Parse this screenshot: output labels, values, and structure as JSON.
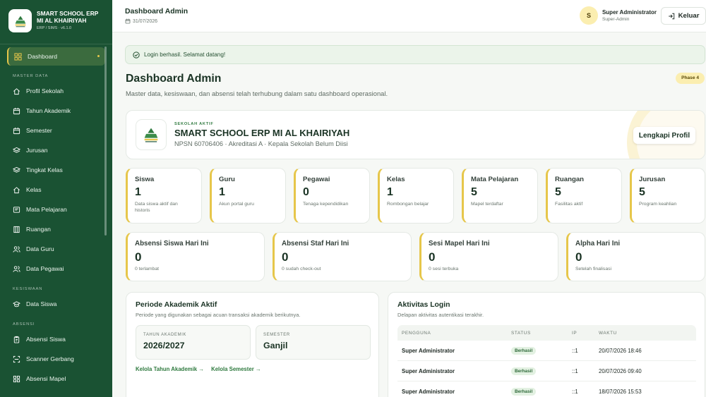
{
  "brand": {
    "name": "SMART SCHOOL ERP MI AL KHAIRIYAH",
    "sub": "ERP / SIMS · v6.1.0"
  },
  "sidebar": {
    "active": {
      "label": "Dashboard",
      "icon": "grid-icon"
    },
    "sections": [
      {
        "title": "MASTER DATA",
        "items": [
          {
            "label": "Profil Sekolah",
            "icon": "home-icon"
          },
          {
            "label": "Tahun Akademik",
            "icon": "calendar-icon"
          },
          {
            "label": "Semester",
            "icon": "calendar-icon"
          },
          {
            "label": "Jurusan",
            "icon": "layers-icon"
          },
          {
            "label": "Tingkat Kelas",
            "icon": "layers-icon"
          },
          {
            "label": "Kelas",
            "icon": "home-icon"
          },
          {
            "label": "Mata Pelajaran",
            "icon": "book-icon"
          },
          {
            "label": "Ruangan",
            "icon": "building-icon"
          },
          {
            "label": "Data Guru",
            "icon": "users-icon"
          },
          {
            "label": "Data Pegawai",
            "icon": "users-icon"
          }
        ]
      },
      {
        "title": "KESISWAAN",
        "items": [
          {
            "label": "Data Siswa",
            "icon": "graduation-cap-icon"
          }
        ]
      },
      {
        "title": "ABSENSI",
        "items": [
          {
            "label": "Absensi Siswa",
            "icon": "clipboard-icon"
          },
          {
            "label": "Scanner Gerbang",
            "icon": "scan-icon"
          },
          {
            "label": "Absensi Mapel",
            "icon": "grid-icon"
          }
        ]
      }
    ]
  },
  "header": {
    "title": "Dashboard Admin",
    "date": "31/07/2026",
    "user_initial": "S",
    "user_name": "Super Administrator",
    "user_role": "Super-Admin",
    "logout_label": "Keluar"
  },
  "alert": {
    "text": "Login berhasil. Selamat datang!"
  },
  "page": {
    "title": "Dashboard Admin",
    "subtitle": "Master data, kesiswaan, dan absensi telah terhubung dalam satu dashboard operasional.",
    "phase": "Phase 4"
  },
  "school": {
    "eyebrow": "SEKOLAH AKTIF",
    "name": "SMART SCHOOL ERP MI AL KHAIRIYAH",
    "meta": "NPSN 60706406 · Akreditasi A · Kepala Sekolah Belum Diisi",
    "button": "Lengkapi Profil"
  },
  "stats": [
    {
      "label": "Siswa",
      "value": "1",
      "desc": "Data siswa aktif dan historis"
    },
    {
      "label": "Guru",
      "value": "1",
      "desc": "Akun portal guru"
    },
    {
      "label": "Pegawai",
      "value": "0",
      "desc": "Tenaga kependidikan"
    },
    {
      "label": "Kelas",
      "value": "1",
      "desc": "Rombongan belajar"
    },
    {
      "label": "Mata Pelajaran",
      "value": "5",
      "desc": "Mapel terdaftar"
    },
    {
      "label": "Ruangan",
      "value": "5",
      "desc": "Fasilitas aktif"
    },
    {
      "label": "Jurusan",
      "value": "5",
      "desc": "Program keahlian"
    }
  ],
  "attendance": [
    {
      "label": "Absensi Siswa Hari Ini",
      "value": "0",
      "desc": "0 terlambat"
    },
    {
      "label": "Absensi Staf Hari Ini",
      "value": "0",
      "desc": "0 sudah check-out"
    },
    {
      "label": "Sesi Mapel Hari Ini",
      "value": "0",
      "desc": "0 sesi terbuka"
    },
    {
      "label": "Alpha Hari Ini",
      "value": "0",
      "desc": "Setelah finalisasi"
    }
  ],
  "academic": {
    "title": "Periode Akademik Aktif",
    "subtitle": "Periode yang digunakan sebagai acuan transaksi akademik berikutnya.",
    "year_label": "TAHUN AKADEMIK",
    "year_value": "2026/2027",
    "semester_label": "SEMESTER",
    "semester_value": "Ganjil",
    "link_year": "Kelola Tahun Akademik →",
    "link_semester": "Kelola Semester →"
  },
  "login_activity": {
    "title": "Aktivitas Login",
    "subtitle": "Delapan aktivitas autentikasi terakhir.",
    "columns": [
      "PENGGUNA",
      "STATUS",
      "IP",
      "WAKTU"
    ],
    "rows": [
      {
        "user": "Super Administrator",
        "status": "Berhasil",
        "ip": "::1",
        "time": "20/07/2026 18:46"
      },
      {
        "user": "Super Administrator",
        "status": "Berhasil",
        "ip": "::1",
        "time": "20/07/2026 09:40"
      },
      {
        "user": "Super Administrator",
        "status": "Berhasil",
        "ip": "::1",
        "time": "18/07/2026 15:53"
      }
    ]
  },
  "colors": {
    "sidebar": "#1a5233",
    "accent": "#e6c64a",
    "primary": "#2f7a3f"
  }
}
